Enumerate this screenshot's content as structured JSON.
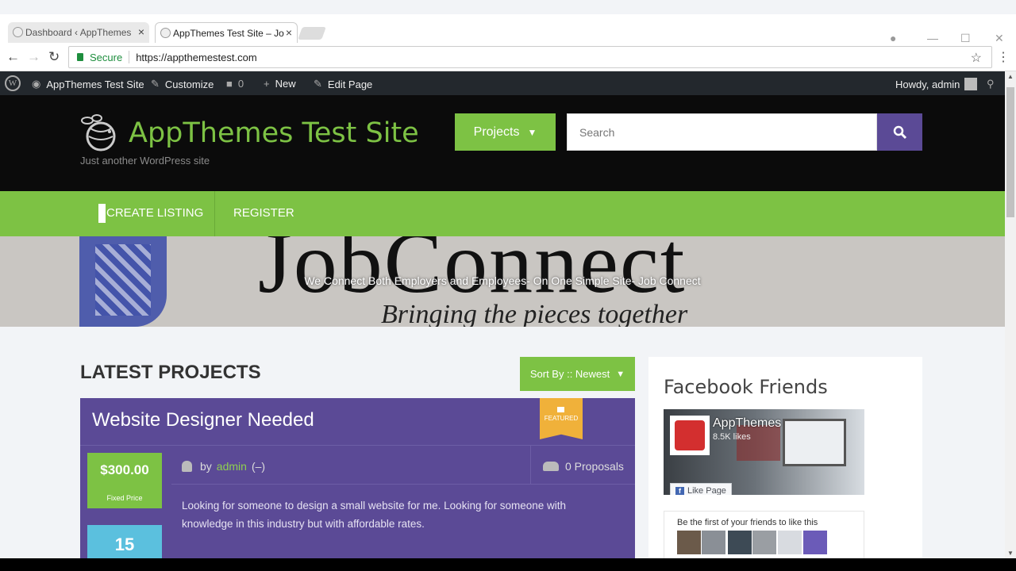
{
  "browser": {
    "tabs": [
      {
        "title": "Dashboard ‹ AppThemes"
      },
      {
        "title": "AppThemes Test Site – Jo"
      }
    ],
    "secure_label": "Secure",
    "url": "https://appthemestest.com"
  },
  "adminbar": {
    "site_name": "AppThemes Test Site",
    "customize": "Customize",
    "comments_count": "0",
    "new_label": "New",
    "edit_page": "Edit Page",
    "howdy": "Howdy, admin"
  },
  "header": {
    "site_title": "AppThemes Test Site",
    "tagline": "Just another WordPress site",
    "projects_button": "Projects",
    "search_placeholder": "Search"
  },
  "menu": {
    "items": [
      {
        "label": "CREATE LISTING"
      },
      {
        "label": "REGISTER"
      }
    ]
  },
  "banner": {
    "logo_text": "JobConnect",
    "script_text": "Bringing the pieces together",
    "caption": "We Connect Both Employers and Employees- On One Simple Site- Job Connect"
  },
  "main": {
    "heading": "LATEST PROJECTS",
    "sort_label": "Sort By :: Newest",
    "project": {
      "title": "Website Designer Needed",
      "badge": "FEATURED",
      "price": "$300.00",
      "price_type": "Fixed Price",
      "days": "15",
      "by": "by",
      "author": "admin",
      "author_suffix": "(–)",
      "proposals": "0 Proposals",
      "description": "Looking for someone to design a small website for me. Looking for someone with knowledge in this industry but with affordable rates."
    }
  },
  "sidebar": {
    "title": "Facebook Friends",
    "fb_page_name": "AppThemes",
    "fb_likes": "8.5K likes",
    "like_button": "Like Page",
    "friends_text": "Be the first of your friends to like this"
  },
  "colors": {
    "accent_green": "#7dc244",
    "accent_purple": "#5b4a96",
    "admin_bar": "#23282d"
  }
}
